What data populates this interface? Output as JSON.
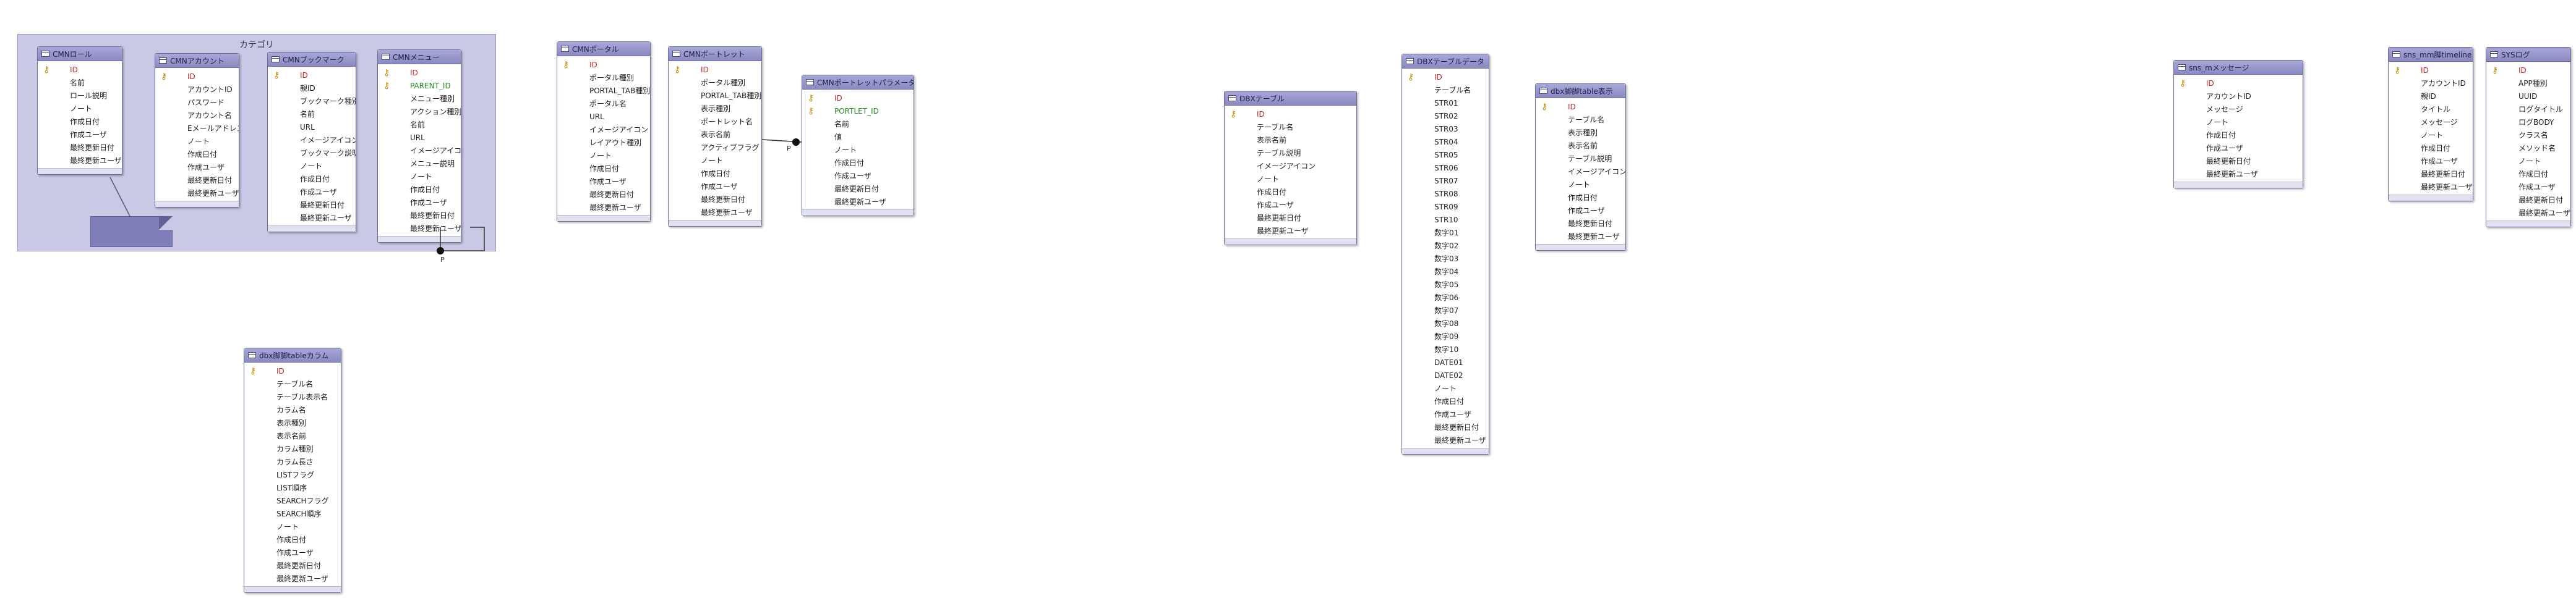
{
  "diagram": {
    "group_label": "カテゴリ",
    "self_ref_label": "P",
    "link_label": "P",
    "entities": [
      {
        "id": "cmn-role",
        "title": "CMNロール",
        "attributes": [
          "ID",
          "名前",
          "ロール説明",
          "ノート",
          "作成日付",
          "作成ユーザ",
          "最終更新日付",
          "最終更新ユーザ"
        ],
        "pk_index": 0,
        "fk_index": -1
      },
      {
        "id": "cmn-account",
        "title": "CMNアカウント",
        "attributes": [
          "ID",
          "アカウントID",
          "パスワード",
          "アカウント名",
          "Eメールアドレス",
          "ノート",
          "作成日付",
          "作成ユーザ",
          "最終更新日付",
          "最終更新ユーザ"
        ],
        "pk_index": 0,
        "fk_index": -1
      },
      {
        "id": "cmn-bookmark",
        "title": "CMNブックマーク",
        "attributes": [
          "ID",
          "親ID",
          "ブックマーク種別",
          "名前",
          "URL",
          "イメージアイコン",
          "ブックマーク説明",
          "ノート",
          "作成日付",
          "作成ユーザ",
          "最終更新日付",
          "最終更新ユーザ"
        ],
        "pk_index": 0,
        "fk_index": -1
      },
      {
        "id": "cmn-menu",
        "title": "CMNメニュー",
        "attributes": [
          "ID",
          "PARENT_ID",
          "メニュー種別",
          "アクション種別",
          "名前",
          "URL",
          "イメージアイコン",
          "メニュー説明",
          "ノート",
          "作成日付",
          "作成ユーザ",
          "最終更新日付",
          "最終更新ユーザ"
        ],
        "pk_index": 0,
        "fk_index": 1
      },
      {
        "id": "cmn-portal",
        "title": "CMNポータル",
        "attributes": [
          "ID",
          "ポータル種別",
          "PORTAL_TAB種別",
          "ポータル名",
          "URL",
          "イメージアイコン",
          "レイアウト種別",
          "ノート",
          "作成日付",
          "作成ユーザ",
          "最終更新日付",
          "最終更新ユーザ"
        ],
        "pk_index": 0,
        "fk_index": -1
      },
      {
        "id": "cmn-portlet",
        "title": "CMNポートレット",
        "attributes": [
          "ID",
          "ポータル種別",
          "PORTAL_TAB種別",
          "表示種別",
          "ポートレット名",
          "表示名前",
          "アクティブフラグ",
          "ノート",
          "作成日付",
          "作成ユーザ",
          "最終更新日付",
          "最終更新ユーザ"
        ],
        "pk_index": 0,
        "fk_index": -1
      },
      {
        "id": "cmn-portlet-param",
        "title": "CMNポートレットパラメーター",
        "attributes": [
          "ID",
          "PORTLET_ID",
          "名前",
          "値",
          "ノート",
          "作成日付",
          "作成ユーザ",
          "最終更新日付",
          "最終更新ユーザ"
        ],
        "pk_index": 0,
        "fk_index": 1
      },
      {
        "id": "dbx-table",
        "title": "DBXテーブル",
        "attributes": [
          "ID",
          "テーブル名",
          "表示名前",
          "テーブル説明",
          "イメージアイコン",
          "ノート",
          "作成日付",
          "作成ユーザ",
          "最終更新日付",
          "最終更新ユーザ"
        ],
        "pk_index": 0,
        "fk_index": -1
      },
      {
        "id": "dbx-table-data",
        "title": "DBXテーブルデータ",
        "attributes": [
          "ID",
          "テーブル名",
          "STR01",
          "STR02",
          "STR03",
          "STR04",
          "STR05",
          "STR06",
          "STR07",
          "STR08",
          "STR09",
          "STR10",
          "数字01",
          "数字02",
          "数字03",
          "数字04",
          "数字05",
          "数字06",
          "数字07",
          "数字08",
          "数字09",
          "数字10",
          "DATE01",
          "DATE02",
          "ノート",
          "作成日付",
          "作成ユーザ",
          "最終更新日付",
          "最終更新ユーザ"
        ],
        "pk_index": 0,
        "fk_index": -1
      },
      {
        "id": "dbx-table-show",
        "title": "dbx脚脚table表示",
        "attributes": [
          "ID",
          "テーブル名",
          "表示種別",
          "表示名前",
          "テーブル説明",
          "イメージアイコン",
          "ノート",
          "作成日付",
          "作成ユーザ",
          "最終更新日付",
          "最終更新ユーザ"
        ],
        "pk_index": 0,
        "fk_index": -1
      },
      {
        "id": "dbx-table-column",
        "title": "dbx脚脚tableカラム",
        "attributes": [
          "ID",
          "テーブル名",
          "テーブル表示名",
          "カラム名",
          "表示種別",
          "表示名前",
          "カラム種別",
          "カラム長さ",
          "LISTフラグ",
          "LIST順序",
          "SEARCHフラグ",
          "SEARCH順序",
          "ノート",
          "作成日付",
          "作成ユーザ",
          "最終更新日付",
          "最終更新ユーザ"
        ],
        "pk_index": 0,
        "fk_index": -1
      },
      {
        "id": "sns-message",
        "title": "sns_mメッセージ",
        "attributes": [
          "ID",
          "アカウントID",
          "メッセージ",
          "ノート",
          "作成日付",
          "作成ユーザ",
          "最終更新日付",
          "最終更新ユーザ"
        ],
        "pk_index": 0,
        "fk_index": -1
      },
      {
        "id": "sns-timeline",
        "title": "sns_mm脚timeline",
        "attributes": [
          "ID",
          "アカウントID",
          "親ID",
          "タイトル",
          "メッセージ",
          "ノート",
          "作成日付",
          "作成ユーザ",
          "最終更新日付",
          "最終更新ユーザ"
        ],
        "pk_index": 0,
        "fk_index": -1
      },
      {
        "id": "sys-log",
        "title": "SYSログ",
        "attributes": [
          "ID",
          "APP種別",
          "UUID",
          "ログタイトル",
          "ログBODY",
          "クラス名",
          "メソッド名",
          "ノート",
          "作成日付",
          "作成ユーザ",
          "最終更新日付",
          "最終更新ユーザ"
        ],
        "pk_index": 0,
        "fk_index": -1
      }
    ]
  }
}
